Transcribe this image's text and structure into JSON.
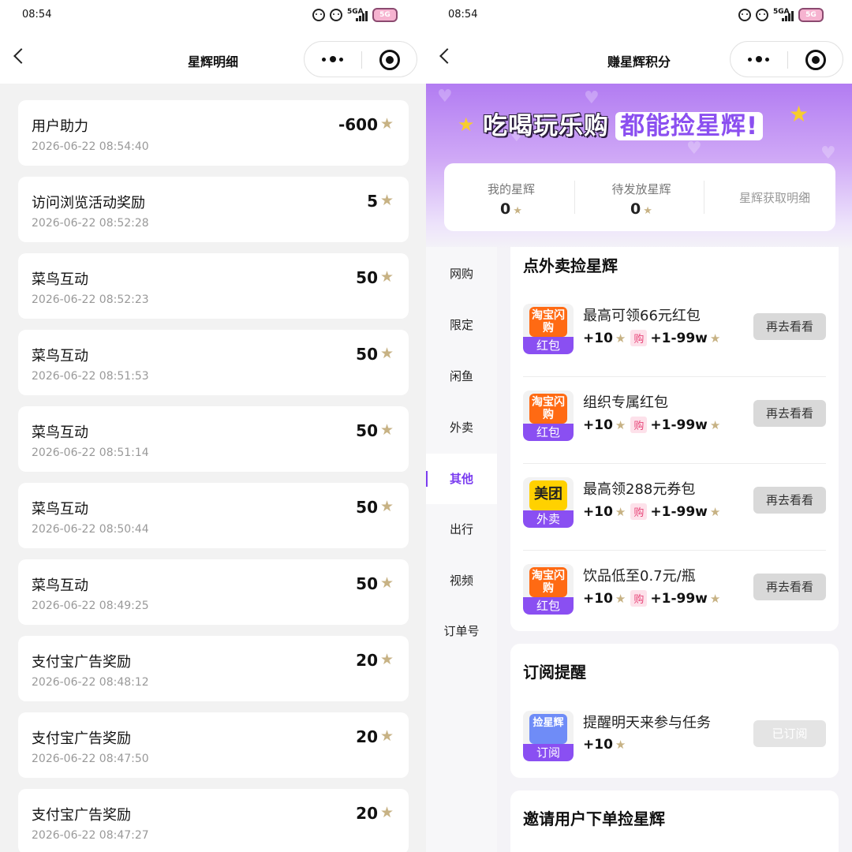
{
  "left": {
    "status": {
      "time": "08:54",
      "network": "5GA",
      "battery": "5G"
    },
    "title": "星辉明细",
    "records": [
      {
        "title": "用户助力",
        "time": "2026-06-22 08:54:40",
        "amount": "-600"
      },
      {
        "title": "访问浏览活动奖励",
        "time": "2026-06-22 08:52:28",
        "amount": "5"
      },
      {
        "title": "菜鸟互动",
        "time": "2026-06-22 08:52:23",
        "amount": "50"
      },
      {
        "title": "菜鸟互动",
        "time": "2026-06-22 08:51:53",
        "amount": "50"
      },
      {
        "title": "菜鸟互动",
        "time": "2026-06-22 08:51:14",
        "amount": "50"
      },
      {
        "title": "菜鸟互动",
        "time": "2026-06-22 08:50:44",
        "amount": "50"
      },
      {
        "title": "菜鸟互动",
        "time": "2026-06-22 08:49:25",
        "amount": "50"
      },
      {
        "title": "支付宝广告奖励",
        "time": "2026-06-22 08:48:12",
        "amount": "20"
      },
      {
        "title": "支付宝广告奖励",
        "time": "2026-06-22 08:47:50",
        "amount": "20"
      },
      {
        "title": "支付宝广告奖励",
        "time": "2026-06-22 08:47:27",
        "amount": "20"
      }
    ]
  },
  "right": {
    "status": {
      "time": "08:54",
      "network": "5GA",
      "battery": "5G"
    },
    "title": "赚星辉积分",
    "banner": {
      "slogan_part1": "吃喝玩乐购",
      "slogan_part2": "都能捡星辉!"
    },
    "points": {
      "mine_label": "我的星辉",
      "mine_value": "0",
      "pending_label": "待发放星辉",
      "pending_value": "0",
      "detail_link": "星辉获取明细"
    },
    "sidenav": [
      "网购",
      "限定",
      "闲鱼",
      "外卖",
      "其他",
      "出行",
      "视频",
      "订单号"
    ],
    "sidenav_active": "其他",
    "takeout": {
      "title": "点外卖捡星辉",
      "tasks": [
        {
          "logo": "淘宝闪购",
          "tag": "红包",
          "name": "最高可领66元红包",
          "reward": "+10",
          "badge": "购",
          "extra": "+1-99w",
          "button": "再去看看",
          "logo_color": "#ff6a13"
        },
        {
          "logo": "淘宝闪购",
          "tag": "红包",
          "name": "组织专属红包",
          "reward": "+10",
          "badge": "购",
          "extra": "+1-99w",
          "button": "再去看看",
          "logo_color": "#ff6a13"
        },
        {
          "logo": "美团",
          "tag": "外卖",
          "name": "最高领288元券包",
          "reward": "+10",
          "badge": "购",
          "extra": "+1-99w",
          "button": "再去看看",
          "logo_color": "#ffd100"
        },
        {
          "logo": "淘宝闪购",
          "tag": "红包",
          "name": "饮品低至0.7元/瓶",
          "reward": "+10",
          "badge": "购",
          "extra": "+1-99w",
          "button": "再去看看",
          "logo_color": "#ff6a13"
        }
      ]
    },
    "subscribe": {
      "title": "订阅提醒",
      "logo": "捡星辉",
      "tag": "订阅",
      "name": "提醒明天来参与任务",
      "reward": "+10",
      "button": "已订阅"
    },
    "invite": {
      "title": "邀请用户下单捡星辉"
    }
  }
}
